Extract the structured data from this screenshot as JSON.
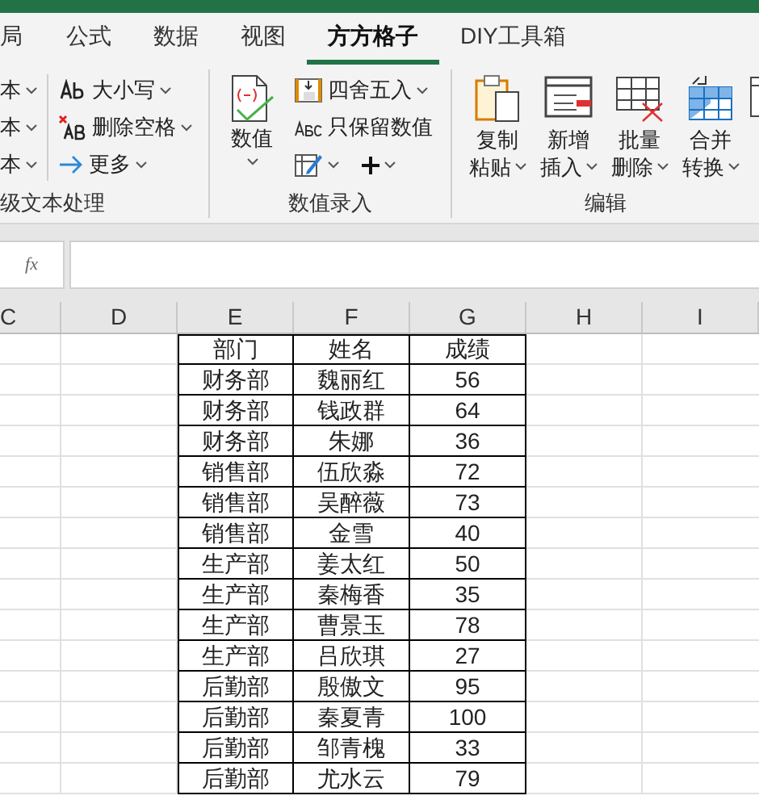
{
  "tabs": [
    {
      "label": "局",
      "selected": false
    },
    {
      "label": "公式",
      "selected": false
    },
    {
      "label": "数据",
      "selected": false
    },
    {
      "label": "视图",
      "selected": false
    },
    {
      "label": "方方格子",
      "selected": true
    },
    {
      "label": "DIY工具箱",
      "selected": false
    }
  ],
  "ribbon": {
    "groups": [
      {
        "label": "级文本处理",
        "items": [
          {
            "kind": "small",
            "label": "本"
          },
          {
            "kind": "small",
            "label": "本"
          },
          {
            "kind": "small",
            "label": "本"
          },
          {
            "kind": "small",
            "label": "大小写"
          },
          {
            "kind": "small",
            "label": "删除空格"
          },
          {
            "kind": "small",
            "label": "更多"
          }
        ]
      },
      {
        "label": "数值录入",
        "items": [
          {
            "kind": "big",
            "label": "数值"
          },
          {
            "kind": "small",
            "label": "四舍五入"
          },
          {
            "kind": "small",
            "label": "只保留数值"
          },
          {
            "kind": "small"
          },
          {
            "kind": "small"
          }
        ]
      },
      {
        "label": "编辑",
        "items": [
          {
            "kind": "big",
            "label": "复制粘贴"
          },
          {
            "kind": "big",
            "label": "新增插入"
          },
          {
            "kind": "big",
            "label": "批量删除"
          },
          {
            "kind": "big",
            "label": "合并转换"
          },
          {
            "kind": "big"
          }
        ]
      }
    ]
  },
  "formula_bar": {
    "fx": "fx"
  },
  "columns": [
    "C",
    "D",
    "E",
    "F",
    "G",
    "H",
    "I"
  ],
  "table": {
    "headers": [
      "部门",
      "姓名",
      "成绩"
    ],
    "rows": [
      [
        "财务部",
        "魏丽红",
        "56"
      ],
      [
        "财务部",
        "钱政群",
        "64"
      ],
      [
        "财务部",
        "朱娜",
        "36"
      ],
      [
        "销售部",
        "伍欣淼",
        "72"
      ],
      [
        "销售部",
        "吴醉薇",
        "73"
      ],
      [
        "销售部",
        "金雪",
        "40"
      ],
      [
        "生产部",
        "姜太红",
        "50"
      ],
      [
        "生产部",
        "秦梅香",
        "35"
      ],
      [
        "生产部",
        "曹景玉",
        "78"
      ],
      [
        "生产部",
        "吕欣琪",
        "27"
      ],
      [
        "后勤部",
        "殷傲文",
        "95"
      ],
      [
        "后勤部",
        "秦夏青",
        "100"
      ],
      [
        "后勤部",
        "邹青槐",
        "33"
      ],
      [
        "后勤部",
        "尤水云",
        "79"
      ]
    ]
  }
}
